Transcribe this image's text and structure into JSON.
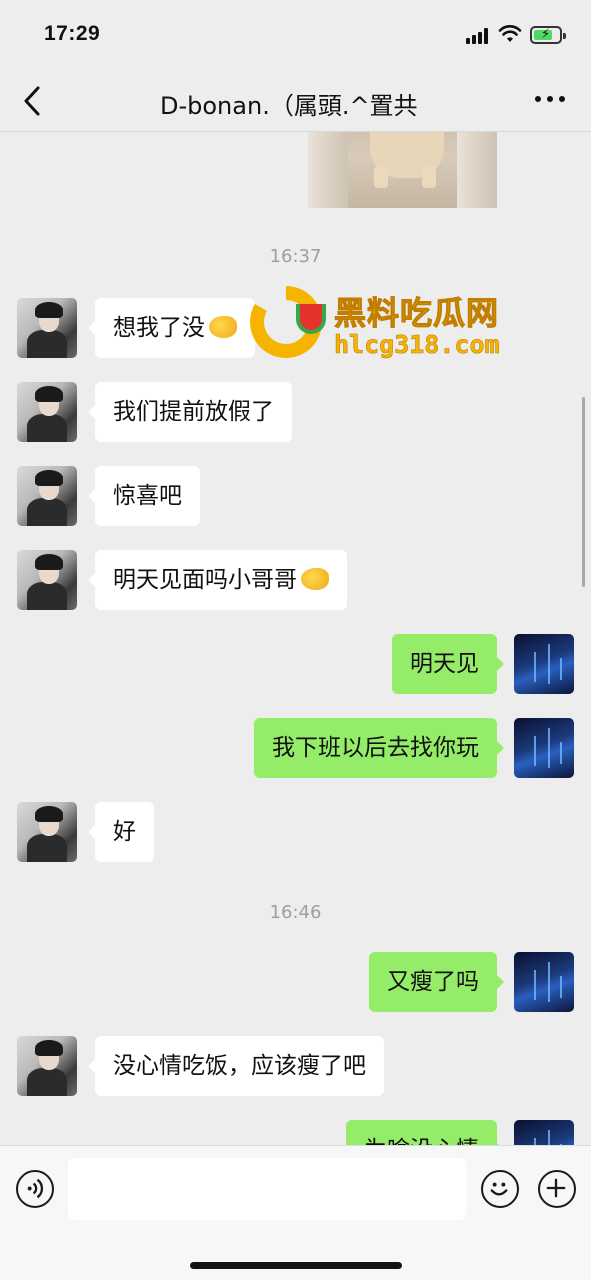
{
  "status_bar": {
    "time": "17:29"
  },
  "header": {
    "title": "D-bonan.（属頭.^置共"
  },
  "watermark": {
    "title": "黑料吃瓜网",
    "url": "hlcg318.com"
  },
  "messages": [
    {
      "type": "image"
    },
    {
      "type": "time",
      "text": "16:37"
    },
    {
      "from": "her",
      "text": "想我了没",
      "emoji": "flexed-arm"
    },
    {
      "from": "her",
      "text": "我们提前放假了"
    },
    {
      "from": "her",
      "text": "惊喜吧"
    },
    {
      "from": "her",
      "text": "明天见面吗小哥哥",
      "emoji": "flexed-arm"
    },
    {
      "from": "me",
      "text": "明天见"
    },
    {
      "from": "me",
      "text": "我下班以后去找你玩"
    },
    {
      "from": "her",
      "text": "好"
    },
    {
      "type": "time",
      "text": "16:46"
    },
    {
      "from": "me",
      "text": "又瘦了吗"
    },
    {
      "from": "her",
      "text": "没心情吃饭，应该瘦了吧"
    },
    {
      "from": "me",
      "text": "为啥没心情"
    }
  ],
  "input_bar": {
    "placeholder": ""
  },
  "icons": [
    "back-icon",
    "more-icon",
    "voice-icon",
    "emoji-icon",
    "plus-icon"
  ]
}
